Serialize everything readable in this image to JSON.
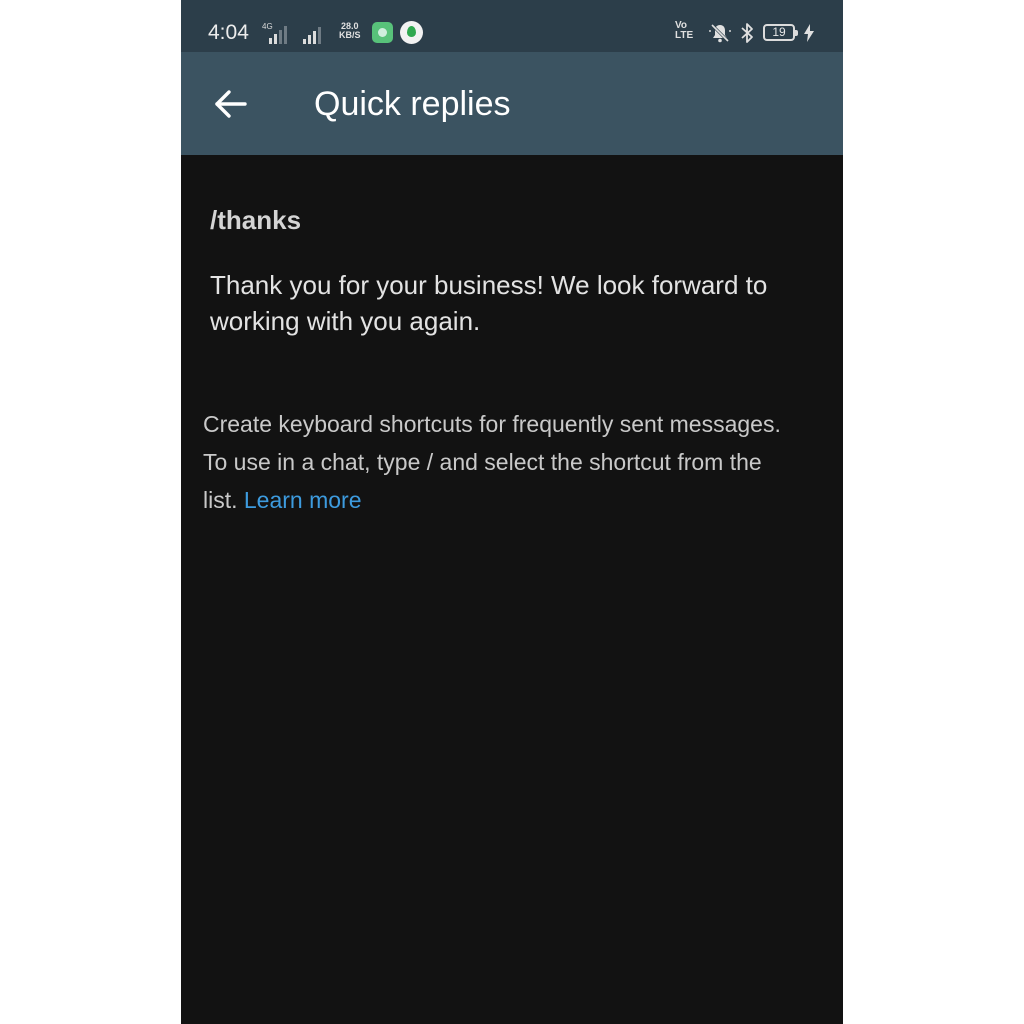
{
  "status_bar": {
    "time": "4:04",
    "network_type": "4G",
    "speed_value": "28.0",
    "speed_unit": "KB/S",
    "volte_top": "Vo",
    "volte_bottom": "LTE",
    "battery_level": "19",
    "icons": [
      "signal-icon",
      "app-notification-icon",
      "vpn-shield-icon",
      "volte-icon",
      "mute-icon",
      "bluetooth-icon",
      "battery-icon",
      "charging-icon"
    ]
  },
  "app_bar": {
    "title": "Quick replies",
    "back_icon": "arrow-left-icon",
    "background": "#3b5361"
  },
  "quick_replies": [
    {
      "shortcut": "/thanks",
      "message": "Thank you for your business! We look forward to working with you again."
    }
  ],
  "info": {
    "text": "Create keyboard shortcuts for frequently sent messages. To use in a chat, type / and select the shortcut from the list. ",
    "link_label": "Learn more",
    "link_color": "#3d9bde"
  },
  "colors": {
    "background": "#121212",
    "status_bar": "#2c3e4a",
    "text_primary": "#e3e3e3",
    "text_secondary": "#c9c9c9"
  }
}
